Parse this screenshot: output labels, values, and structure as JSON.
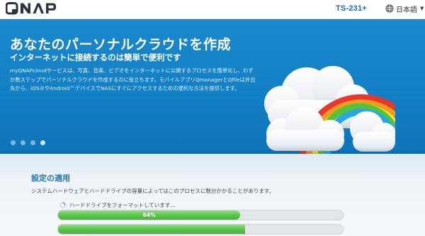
{
  "header": {
    "logo_text": "QNAP",
    "model": "TS-231+",
    "language": "日本語",
    "colors": {
      "brand": "#2a3340",
      "model": "#1d6ab3"
    }
  },
  "banner": {
    "title": "あなたのパーソナルクラウドを作成",
    "subtitle": "インターネットに接続するのは簡単で便利です",
    "description": "myQNAPcloudサービスは、写真、音楽、ビデオをインターネットに公開するプロセスを簡単化し、わずか数ステップでパーソナルクラウドを作成するのに役立ちます。モバイルアプリQmanagerとQfileは外出先から、iOS®やAndroid™デバイスでNASにすぐにアクセスするための便利な方法を提供します。",
    "slides": 4,
    "active_slide": 3,
    "background_color": "#137fc4"
  },
  "setup": {
    "title": "設定の適用",
    "description": "システムハードウェアとハードドライブの容量によってはこのプロセスに数分かかることがあります。",
    "status_text": "ハードドライブをフォーマットしています...",
    "progress_percent": 64,
    "progress_label": "64%",
    "progress_color": "#5cc54c"
  }
}
